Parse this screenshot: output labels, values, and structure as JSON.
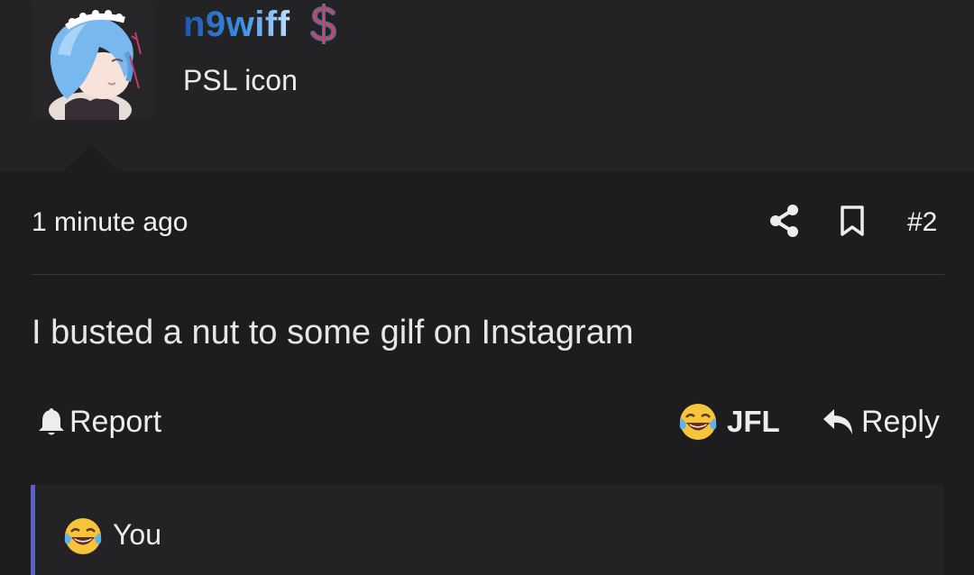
{
  "user": {
    "name": "n9wiff",
    "title": "PSL icon",
    "avatar": "anime-avatar",
    "badge_icon": "dollar-icon"
  },
  "post": {
    "timestamp": "1 minute ago",
    "number": "#2",
    "body": "I busted a nut to some gilf on Instagram"
  },
  "actions": {
    "report_label": "Report",
    "reaction_label": "JFL",
    "reply_label": "Reply"
  },
  "reactions": {
    "summary": "You",
    "accent_color": "#5b5fc7"
  },
  "colors": {
    "background": "#1d1d1f",
    "header_background": "#232325",
    "username_gradient_start": "#1e56a8",
    "username_gradient_end": "#bfe2ff"
  }
}
